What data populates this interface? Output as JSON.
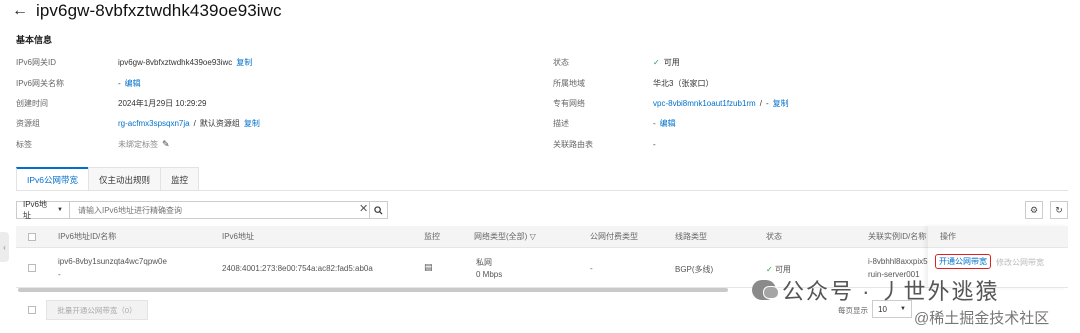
{
  "header": {
    "back_icon": "arrow-left-icon",
    "title": "ipv6gw-8vbfxztwdhk439oe93iwc"
  },
  "basic_info": {
    "section_title": "基本信息",
    "left": [
      {
        "label": "IPv6网关ID",
        "value": "ipv6gw-8vbfxztwdhk439oe93iwc",
        "link": "复制"
      },
      {
        "label": "IPv6网关名称",
        "value": "-",
        "link": "编辑"
      },
      {
        "label": "创建时间",
        "value": "2024年1月29日 10:29:29"
      },
      {
        "label": "资源组",
        "value": "rg-acfmx3spsqxn7ja",
        "sep": "/",
        "value2": "默认资源组",
        "link": "复制"
      },
      {
        "label": "标签",
        "value": "未绑定标签"
      }
    ],
    "right": [
      {
        "label": "状态",
        "value": "可用"
      },
      {
        "label": "所属地域",
        "value": "华北3（张家口）"
      },
      {
        "label": "专有网络",
        "value": "vpc-8vbi8mnk1oaut1fzub1rm",
        "sep": "/",
        "value2": "-",
        "link": "复制"
      },
      {
        "label": "描述",
        "value": "-",
        "link": "编辑"
      },
      {
        "label": "关联路由表",
        "value": "-"
      }
    ]
  },
  "tabs": [
    "IPv6公网带宽",
    "仅主动出规则",
    "监控"
  ],
  "toolbar": {
    "select_value": "IPv6地址",
    "search_placeholder": "请输入IPv6地址进行精确查询"
  },
  "table": {
    "headers": [
      "IPv6地址ID/名称",
      "IPv6地址",
      "监控",
      "网络类型(全部)",
      "公网付费类型",
      "线路类型",
      "状态",
      "关联实例ID/名称",
      "操作"
    ],
    "row": {
      "id": "ipv6-8vby1sunzqta4wc7qpw0e",
      "name": "-",
      "address": "2408:4001:273:8e00:754a:ac82:fad5:ab0a",
      "network_type": "私网",
      "bandwidth": "0 Mbps",
      "pay_type": "-",
      "line_type": "BGP(多线)",
      "status": "可用",
      "instance_id": "i-8vbhhl8axxpix5",
      "instance_name": "ruin-server001",
      "op_primary": "开通公网带宽",
      "op_secondary": "修改公网带宽"
    }
  },
  "footer": {
    "bulk_button": "批量开通公网带宽（0）",
    "page_size_label": "每页显示",
    "page_size": "10"
  },
  "watermark": {
    "text": "公众号 · 丿世外逃猿",
    "text2": "@稀土掘金技术社区"
  },
  "colors": {
    "link": "#0070cc",
    "ok": "#24a148",
    "highlight": "#e02020"
  }
}
